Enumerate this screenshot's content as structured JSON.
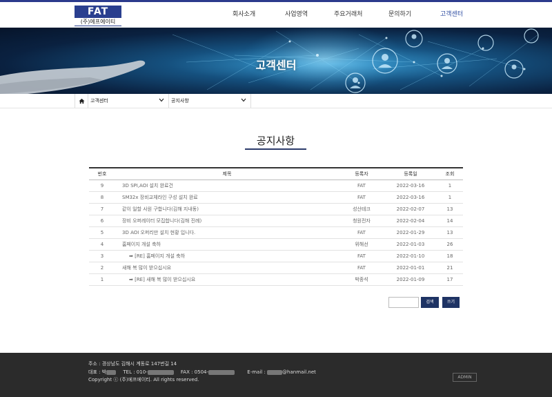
{
  "header": {
    "logo_main": "FAT",
    "logo_sub": "(주)에프에이티",
    "nav": [
      "회사소개",
      "사업영역",
      "주요거래처",
      "문의하기",
      "고객센터"
    ],
    "active_nav": "고객센터"
  },
  "banner": {
    "title": "고객센터"
  },
  "breadcrumb": {
    "level1": "고객센터",
    "level2": "공지사항"
  },
  "page_title": "공지사항",
  "board": {
    "columns": [
      "번호",
      "제목",
      "등록자",
      "등록일",
      "조회"
    ],
    "rows": [
      {
        "no": "9",
        "subject": "3D SPI,AOI 설치 완료건",
        "author": "FAT",
        "date": "2022-03-16",
        "views": "1",
        "reply": false
      },
      {
        "no": "8",
        "subject": "SM32x 장비교체라인 구성 설치 완료",
        "author": "FAT",
        "date": "2022-03-16",
        "views": "1",
        "reply": false
      },
      {
        "no": "7",
        "subject": "같이 일할 사원 구합니다(김해 지내동)",
        "author": "성산테크",
        "date": "2022-02-07",
        "views": "13",
        "reply": false
      },
      {
        "no": "6",
        "subject": "장비 오퍼레이터 모집합니다(김해 진례)",
        "author": "청원전자",
        "date": "2022-02-04",
        "views": "14",
        "reply": false
      },
      {
        "no": "5",
        "subject": "3D AOI 오퍼리만 설치 현황 입니다.",
        "author": "FAT",
        "date": "2022-01-29",
        "views": "13",
        "reply": false
      },
      {
        "no": "4",
        "subject": "홈페이지 개설 축하",
        "author": "위해선",
        "date": "2022-01-03",
        "views": "26",
        "reply": false
      },
      {
        "no": "3",
        "subject": "➡ [RE] 홈페이지 개설 축하",
        "author": "FAT",
        "date": "2022-01-10",
        "views": "18",
        "reply": true
      },
      {
        "no": "2",
        "subject": "새해 복 많이 받으십시요",
        "author": "FAT",
        "date": "2022-01-01",
        "views": "21",
        "reply": false
      },
      {
        "no": "1",
        "subject": "➡ [RE] 새해 복 많이 받으십시요",
        "author": "박종석",
        "date": "2022-01-09",
        "views": "17",
        "reply": true
      }
    ]
  },
  "search": {
    "value": "",
    "button": "검색",
    "write_button": "쓰기"
  },
  "footer": {
    "address": "주소 : 경상남도 김해시 계동로 147번길 14",
    "rep_label": "대표 : 박",
    "tel_label": "TEL : 010-",
    "fax_label": "FAX : 0504-",
    "email_label": "E-mail :",
    "email_domain": "@hanmail.net",
    "copyright": "Copyright ⓒ (주)에프에이티. All rights reserved.",
    "admin": "ADMIN"
  },
  "colors": {
    "brand": "#2a3f8f",
    "button": "#1e3364",
    "footer_bg": "#2b2b2b"
  },
  "icons": [
    "home-icon",
    "chevron-down-icon"
  ]
}
